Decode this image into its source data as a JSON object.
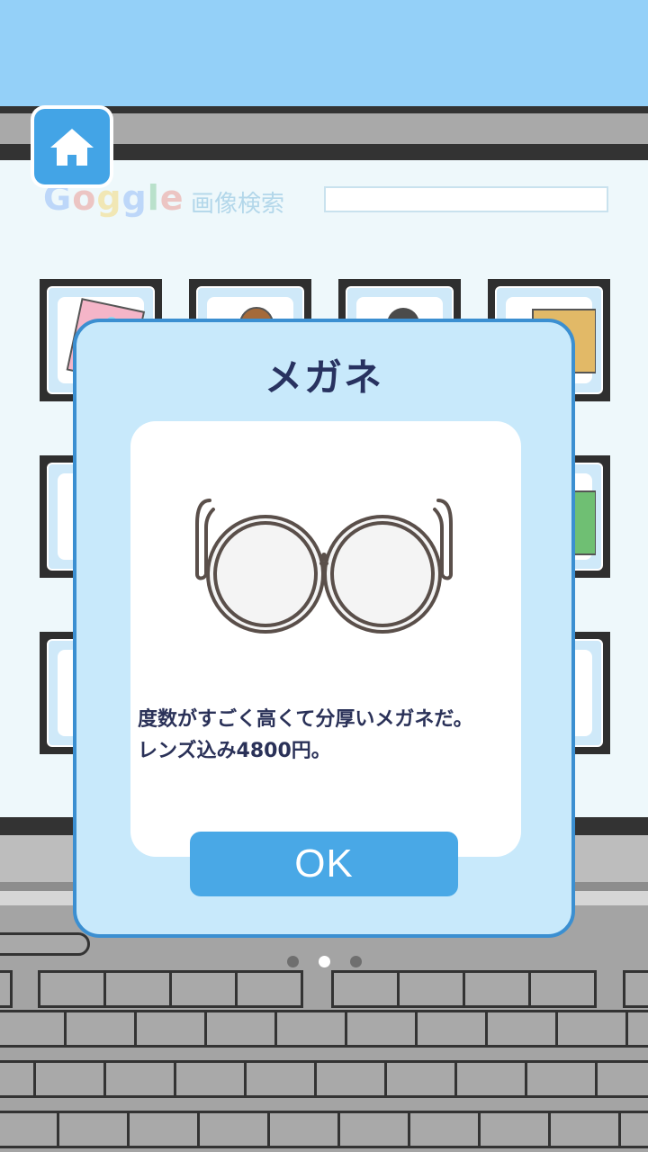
{
  "header": {
    "home_icon": "home-icon"
  },
  "search_page": {
    "logo_text": "Goggle",
    "logo_sub": "画像検索",
    "search_value": ""
  },
  "dialog": {
    "title": "メガネ",
    "item_icon": "glasses-icon",
    "description": "度数がすごく高くて分厚いメガネだ。\nレンズ込み4800円。",
    "ok_label": "OK"
  },
  "pagination": {
    "current": 2,
    "total": 3
  },
  "colors": {
    "accent": "#49a8e6",
    "dialog_border": "#3b8fd1",
    "dialog_bg": "#c8e9fb",
    "title_text": "#283260"
  }
}
